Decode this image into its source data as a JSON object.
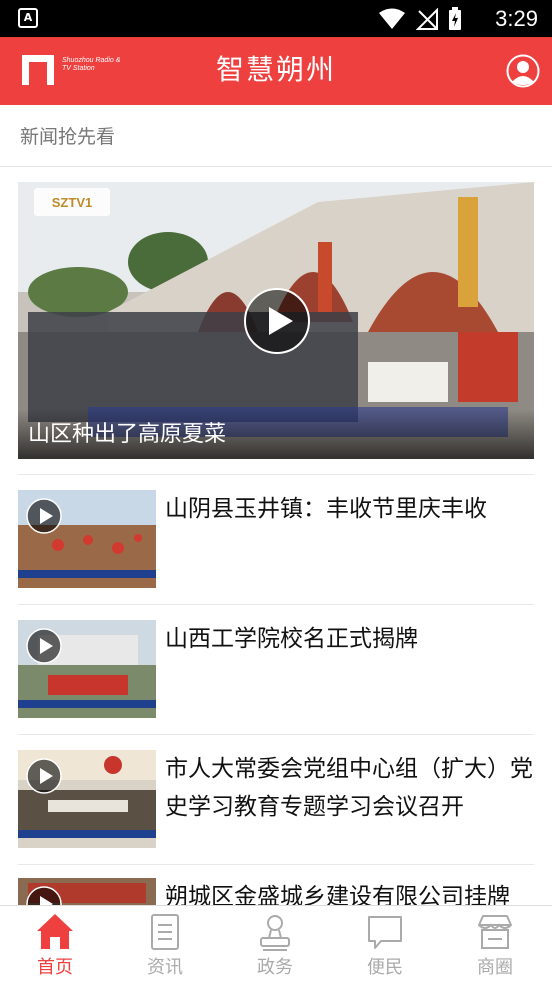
{
  "status_bar": {
    "notification_icon": "a-notification-icon",
    "time": "3:29"
  },
  "header": {
    "logo_text": "Shuozhou Radio & TV Station",
    "title": "智慧朔州",
    "user_icon": "user-icon",
    "background_color": "#ef4040"
  },
  "section": {
    "label": "新闻抢先看"
  },
  "featured": {
    "title": "山区种出了高原夏菜",
    "channel_logo": "SZTV1"
  },
  "news": [
    {
      "title": "山阴县玉井镇：丰收节里庆丰收"
    },
    {
      "title": "山西工学院校名正式揭牌"
    },
    {
      "title": "市人大常委会党组中心组（扩大）党史学习教育专题学习会议召开"
    },
    {
      "title": "朔城区金盛城乡建设有限公司挂牌"
    }
  ],
  "tabs": [
    {
      "label": "首页",
      "icon": "home-icon",
      "active": true
    },
    {
      "label": "资讯",
      "icon": "document-icon",
      "active": false
    },
    {
      "label": "政务",
      "icon": "stamp-icon",
      "active": false
    },
    {
      "label": "便民",
      "icon": "chat-bubble-icon",
      "active": false
    },
    {
      "label": "商圈",
      "icon": "store-icon",
      "active": false
    }
  ],
  "colors": {
    "accent": "#ef4040",
    "inactive_tab": "#aaaaaa"
  }
}
